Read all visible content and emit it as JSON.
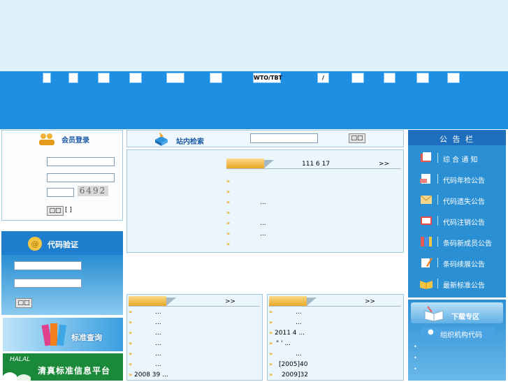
{
  "nav": {
    "items": [
      "",
      "",
      "",
      "",
      "",
      "",
      "WTO/TBT",
      "/",
      "",
      "",
      "",
      ""
    ]
  },
  "login": {
    "title": "会员登录",
    "captcha": "6492",
    "login_button": "□□",
    "bracket": "[ ]"
  },
  "search": {
    "title": "站内检索",
    "button": "□□"
  },
  "news": {
    "date": "111 6 17",
    "more": ">>",
    "items": [
      "",
      "",
      "...",
      "",
      "...",
      "...",
      ""
    ]
  },
  "code_verify": {
    "title": "代码验证",
    "button": "□□"
  },
  "standard_query": {
    "label": "标准查询"
  },
  "halal": {
    "tag": "HALAL",
    "title": "清真标准信息平台"
  },
  "bottom_left": {
    "more": ">>",
    "items": [
      "...",
      "...",
      "...",
      "...",
      "...",
      "...",
      "2008 39 ..."
    ]
  },
  "bottom_right": {
    "more": ">>",
    "items": [
      "...",
      "...",
      "2011 4 ...",
      "\" ' ...",
      "...",
      "[2005]40",
      "2009]32"
    ]
  },
  "announce": {
    "title": "公 告 栏",
    "items": [
      "综 合 通 知",
      "代码年检公告",
      "代码遗失公告",
      "代码注销公告",
      "条码新成员公告",
      "条码续展公告",
      "最新标准公告"
    ]
  },
  "download": {
    "title": "下载专区",
    "item": "组织机构代码",
    "dots": [
      "•",
      "•",
      "•",
      "•"
    ]
  },
  "colors": {
    "banner": "#dcf1f8",
    "navbar": "#1f8fe4",
    "announce_bg": "#2b8fd3",
    "bullet": "#e8a400"
  }
}
